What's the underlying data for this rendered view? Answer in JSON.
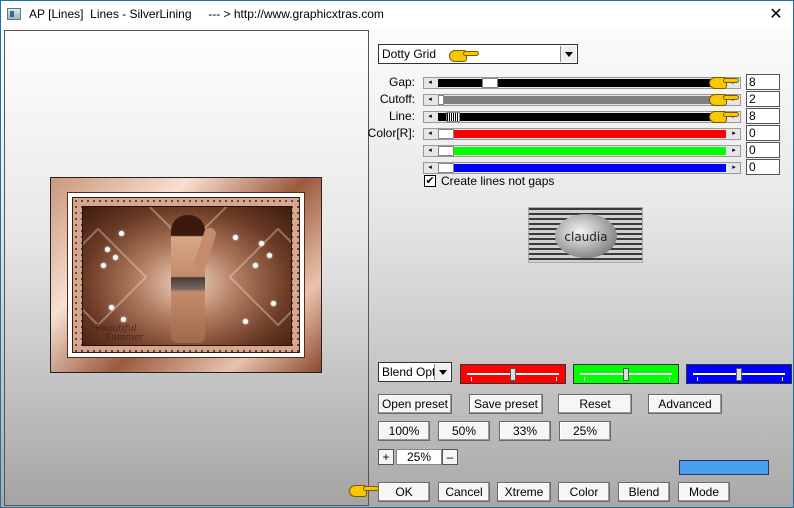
{
  "window": {
    "title": "AP [Lines]  Lines - SilverLining     --- > http://www.graphicxtras.com",
    "close_glyph": "✕"
  },
  "preview": {
    "watermark_line1": "Beautiful",
    "watermark_line2": "Summer"
  },
  "controls": {
    "pattern_select": {
      "value": "Dotty Grid"
    },
    "sliders": [
      {
        "label": "Gap:",
        "value": "8",
        "fill_color": "#000000"
      },
      {
        "label": "Cutoff:",
        "value": "2",
        "fill_color": "#808080"
      },
      {
        "label": "Line:",
        "value": "8",
        "fill_color": "#000000"
      },
      {
        "label": "Color[R]:",
        "value": "0",
        "fill_color": "#ff0000"
      },
      {
        "label": "",
        "value": "0",
        "fill_color": "#00ff00"
      },
      {
        "label": "",
        "value": "0",
        "fill_color": "#0000ff"
      }
    ],
    "create_lines_checkbox": {
      "checked": true,
      "check_glyph": "✔",
      "label": "Create lines not gaps"
    },
    "thumbnail_logo_text": "claudia",
    "blend_select": {
      "value": "Blend Optio"
    },
    "color_blend_sliders": [
      {
        "color": "#ff0000"
      },
      {
        "color": "#00ff00"
      },
      {
        "color": "#0000ff"
      }
    ],
    "buttons_row1": [
      "Open preset",
      "Save preset",
      "Reset",
      "Advanced"
    ],
    "zoom_buttons": [
      "100%",
      "50%",
      "33%",
      "25%"
    ],
    "zoom": {
      "plus": "+",
      "value": "25%",
      "minus": "–"
    },
    "color_swatch": "#4aa0f0",
    "bottom_buttons": [
      "OK",
      "Cancel",
      "Xtreme",
      "Color",
      "Blend",
      "Mode"
    ]
  }
}
